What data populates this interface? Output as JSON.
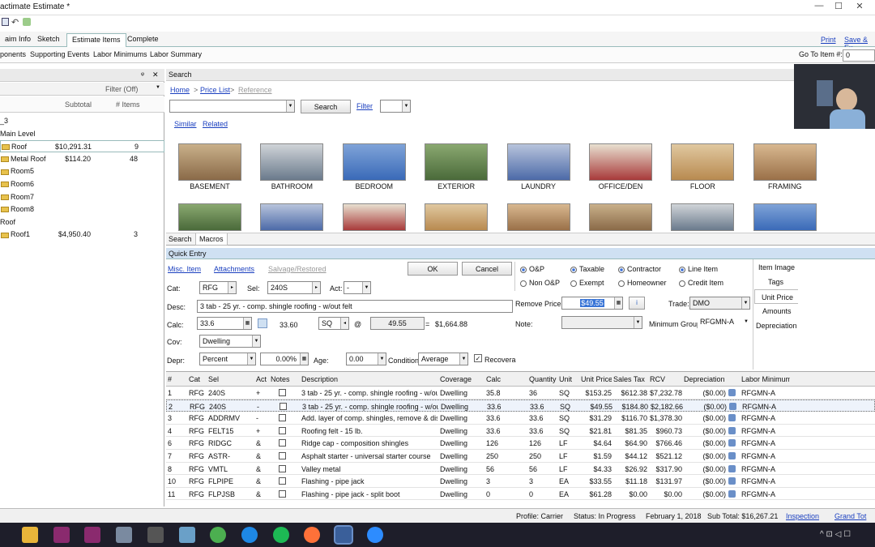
{
  "window": {
    "title": "actimate Estimate *",
    "min": "—",
    "max": "☐",
    "close": "✕"
  },
  "tabs": [
    {
      "label": "aim Info"
    },
    {
      "label": "Sketch"
    },
    {
      "label": "Estimate Items"
    },
    {
      "label": "Complete"
    }
  ],
  "top_links": {
    "print": "Print",
    "save": "Save & Ex"
  },
  "subtabs": [
    "ponents",
    "Supporting Events",
    "Labor Minimums",
    "Labor Summary"
  ],
  "goto": {
    "label": "Go To Item #:",
    "value": "0"
  },
  "left": {
    "pin": "ᵠ",
    "close": "✕",
    "filter": "Filter (Off)",
    "col_subtotal": "Subtotal",
    "col_items": "# Items",
    "tree": [
      {
        "label": "_3",
        "subtotal": "",
        "items": ""
      },
      {
        "label": "Main Level",
        "subtotal": "",
        "items": ""
      },
      {
        "label": "Roof",
        "subtotal": "$10,291.31",
        "items": "9",
        "folder": true
      },
      {
        "label": "Metal Roof",
        "subtotal": "$114.20",
        "items": "48",
        "folder": true
      },
      {
        "label": "Room5",
        "subtotal": "",
        "items": "",
        "folder": true
      },
      {
        "label": "Room6",
        "subtotal": "",
        "items": "",
        "folder": true
      },
      {
        "label": "Room7",
        "subtotal": "",
        "items": "",
        "folder": true
      },
      {
        "label": "Room8",
        "subtotal": "",
        "items": "",
        "folder": true
      },
      {
        "label": "Roof",
        "subtotal": "",
        "items": ""
      },
      {
        "label": "Roof1",
        "subtotal": "$4,950.40",
        "items": "3",
        "folder": true
      }
    ]
  },
  "search": {
    "title": "Search",
    "crumbs": {
      "home": "Home",
      "price_list": "Price List",
      "reference": "Reference",
      "sep": ">"
    },
    "button": "Search",
    "filter": "Filter",
    "similar": "Similar",
    "related": "Related",
    "categories": [
      "BASEMENT",
      "BATHROOM",
      "BEDROOM",
      "EXTERIOR",
      "LAUNDRY",
      "OFFICE/DEN",
      "FLOOR",
      "FRAMING"
    ],
    "bottom_tabs": [
      "Search",
      "Macros"
    ]
  },
  "quick_entry": {
    "title": "Quick Entry",
    "links": {
      "misc": "Misc. Item",
      "attachments": "Attachments",
      "salvage": "Salvage/Restored"
    },
    "ok": "OK",
    "cancel": "Cancel",
    "cat_label": "Cat:",
    "cat_value": "RFG",
    "sel_label": "Sel:",
    "sel_value": "240S",
    "act_label": "Act:",
    "act_value": "-",
    "desc_label": "Desc:",
    "desc_value": "3 tab - 25 yr. - comp. shingle roofing - w/out felt",
    "calc_label": "Calc:",
    "calc_value": "33.6",
    "calc_result": "33.60",
    "unit": "SQ",
    "at": "@",
    "price": "49.55",
    "equals": "=",
    "total": "$1,664.88",
    "cov_label": "Cov:",
    "cov_value": "Dwelling",
    "depr_label": "Depr:",
    "depr_value": "Percent",
    "depr_pct": "0.00%",
    "age_label": "Age:",
    "age_value": "0.00",
    "condition_label": "Condition:",
    "condition_value": "Average",
    "recoverable": "Recovera",
    "radios": {
      "op": "O&P",
      "nonop": "Non O&P",
      "taxable": "Taxable",
      "exempt": "Exempt",
      "contractor": "Contractor",
      "homeowner": "Homeowner",
      "line_item": "Line Item",
      "credit_item": "Credit Item"
    },
    "remove_price_label": "Remove Price:",
    "remove_price_value": "$49.55",
    "trade_label": "Trade:",
    "trade_value": "DMO",
    "note_label": "Note:",
    "min_group_label": "Minimum Group:",
    "min_group_value": "RFGMN-A",
    "side_tabs": [
      "Item Image",
      "Tags",
      "Unit Price",
      "Amounts",
      "Depreciation"
    ]
  },
  "grid": {
    "headers": [
      "#",
      "Cat",
      "Sel",
      "Act",
      "Notes",
      "Description",
      "Coverage",
      "Calc",
      "Quantity",
      "Unit",
      "Unit Price",
      "Sales Tax",
      "RCV",
      "Depreciation",
      "",
      "Labor Minimum"
    ],
    "rows": [
      [
        "1",
        "RFG",
        "240S",
        "+",
        "3 tab - 25 yr. - comp. shingle roofing - w/out felt",
        "Dwelling",
        "35.8",
        "36",
        "SQ",
        "$153.25",
        "$612.38",
        "$7,232.78",
        "($0.00)",
        "RFGMN-A"
      ],
      [
        "2",
        "RFG",
        "240S",
        "-",
        "3 tab - 25 yr. - comp. shingle roofing - w/out felt",
        "Dwelling",
        "33.6",
        "33.6",
        "SQ",
        "$49.55",
        "$184.80",
        "$2,182.66",
        "($0.00)",
        "RFGMN-A"
      ],
      [
        "3",
        "RFG",
        "ADDRMV",
        "-",
        "Add. layer of comp. shingles, remove & disp.",
        "Dwelling",
        "33.6",
        "33.6",
        "SQ",
        "$31.29",
        "$116.70",
        "$1,378.30",
        "($0.00)",
        "RFGMN-A"
      ],
      [
        "4",
        "RFG",
        "FELT15",
        "+",
        "Roofing felt - 15 lb.",
        "Dwelling",
        "33.6",
        "33.6",
        "SQ",
        "$21.81",
        "$81.35",
        "$960.73",
        "($0.00)",
        "RFGMN-A"
      ],
      [
        "6",
        "RFG",
        "RIDGC",
        "&",
        "Ridge cap - composition shingles",
        "Dwelling",
        "126",
        "126",
        "LF",
        "$4.64",
        "$64.90",
        "$766.46",
        "($0.00)",
        "RFGMN-A"
      ],
      [
        "7",
        "RFG",
        "ASTR-",
        "&",
        "Asphalt starter - universal starter course",
        "Dwelling",
        "250",
        "250",
        "LF",
        "$1.59",
        "$44.12",
        "$521.12",
        "($0.00)",
        "RFGMN-A"
      ],
      [
        "8",
        "RFG",
        "VMTL",
        "&",
        "Valley metal",
        "Dwelling",
        "56",
        "56",
        "LF",
        "$4.33",
        "$26.92",
        "$317.90",
        "($0.00)",
        "RFGMN-A"
      ],
      [
        "10",
        "RFG",
        "FLPIPE",
        "&",
        "Flashing - pipe jack",
        "Dwelling",
        "3",
        "3",
        "EA",
        "$33.55",
        "$11.18",
        "$131.97",
        "($0.00)",
        "RFGMN-A"
      ],
      [
        "11",
        "RFG",
        "FLPJSB",
        "&",
        "Flashing - pipe jack - split boot",
        "Dwelling",
        "0",
        "0",
        "EA",
        "$61.28",
        "$0.00",
        "$0.00",
        "($0.00)",
        "RFGMN-A"
      ]
    ]
  },
  "status": {
    "profile": "Profile:  Carrier",
    "status": "Status:  In Progress",
    "date": "February 1, 2018",
    "subtotal": "Sub Total: $16,267.21",
    "inspection": "Inspection",
    "grand_total": "Grand Tot"
  },
  "taskbar": {
    "icons": [
      "file-explorer-icon",
      "app-icon",
      "app-icon",
      "paint-icon",
      "calculator-icon",
      "notepad-icon",
      "chrome-icon",
      "edge-icon",
      "spotify-icon",
      "firefox-icon",
      "xactimate-icon",
      "zoom-icon"
    ],
    "colors": [
      "#e8b53a",
      "#8a2a6e",
      "#8a2a6e",
      "#7a8aa0",
      "#555",
      "#6aa0c8",
      "#4caf50",
      "#1e88e5",
      "#1db954",
      "#ff7139",
      "#3a5f9a",
      "#2d8cff"
    ],
    "tray": "^ ⊡ ◁ ☐"
  }
}
